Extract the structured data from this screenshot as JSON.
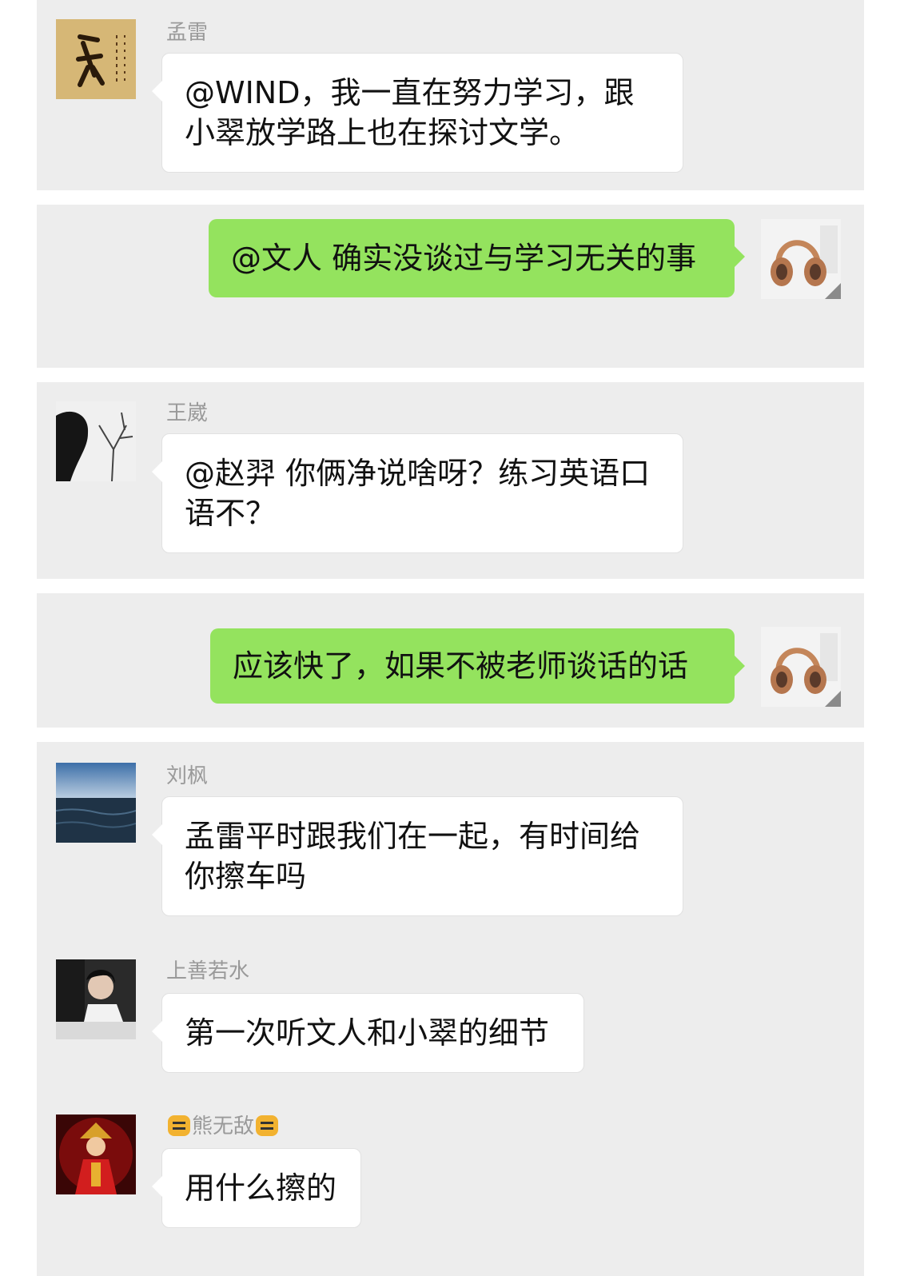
{
  "messages": [
    {
      "sender": "孟雷",
      "text": "@WIND，我一直在努力学习，跟小翠放学路上也在探讨文学。",
      "side": "left",
      "avatar_icon": "calligraphy-avatar-icon"
    },
    {
      "text": "@文人 确实没谈过与学习无关的事",
      "side": "right",
      "avatar_icon": "headphones-avatar-icon"
    },
    {
      "sender": "王崴",
      "text": "@赵羿 你俩净说啥呀？练习英语口语不？",
      "side": "left",
      "avatar_icon": "tree-silhouette-avatar-icon"
    },
    {
      "text": "应该快了，如果不被老师谈话的话",
      "side": "right",
      "avatar_icon": "headphones-avatar-icon"
    },
    {
      "sender": "刘枫",
      "text": "孟雷平时跟我们在一起，有时间给你擦车吗",
      "side": "left",
      "avatar_icon": "sea-avatar-icon"
    },
    {
      "sender": "上善若水",
      "text": "第一次听文人和小翠的细节",
      "side": "left",
      "avatar_icon": "person-writing-avatar-icon"
    },
    {
      "sender": "熊无敌",
      "text": "用什么擦的",
      "side": "left",
      "avatar_icon": "red-figure-avatar-icon",
      "sender_icon": "tiger-emoji-icon"
    }
  ],
  "colors": {
    "panel_bg": "#ededed",
    "sent_bubble": "#94e35e",
    "received_bubble": "#ffffff",
    "sender_name": "#9a9a9a"
  }
}
